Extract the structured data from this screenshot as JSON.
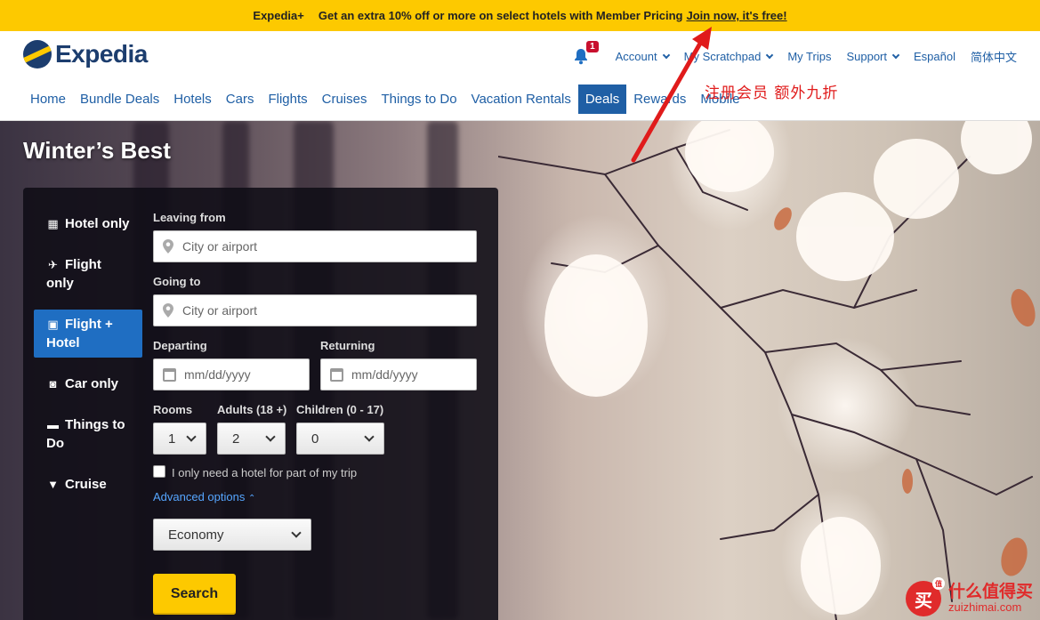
{
  "promo": {
    "brand": "Expedia+",
    "message": "Get an extra 10% off or more on select hotels with Member Pricing",
    "join_link": "Join now, it's free!"
  },
  "header": {
    "logo_text": "Expedia",
    "notification_count": "1",
    "utility_links": [
      {
        "label": "Account",
        "dropdown": true
      },
      {
        "label": "My Scratchpad",
        "dropdown": true
      },
      {
        "label": "My Trips",
        "dropdown": false
      },
      {
        "label": "Support",
        "dropdown": true
      },
      {
        "label": "Español",
        "dropdown": false
      },
      {
        "label": "简体中文",
        "dropdown": false
      }
    ],
    "nav": [
      {
        "label": "Home",
        "active": false
      },
      {
        "label": "Bundle Deals",
        "active": false
      },
      {
        "label": "Hotels",
        "active": false
      },
      {
        "label": "Cars",
        "active": false
      },
      {
        "label": "Flights",
        "active": false
      },
      {
        "label": "Cruises",
        "active": false
      },
      {
        "label": "Things to Do",
        "active": false
      },
      {
        "label": "Vacation Rentals",
        "active": false
      },
      {
        "label": "Deals",
        "active": true
      },
      {
        "label": "Rewards",
        "active": false
      },
      {
        "label": "Mobile",
        "active": false
      }
    ]
  },
  "annotation": {
    "text": "注册会员  额外九折",
    "color": "#e01b1b"
  },
  "hero": {
    "title": "Winter’s Best"
  },
  "search": {
    "tabs": [
      {
        "label": "Hotel only",
        "icon": "building-icon",
        "active": false
      },
      {
        "label": "Flight only",
        "icon": "plane-icon",
        "active": false
      },
      {
        "label": "Flight + Hotel",
        "icon": "suitcase-icon",
        "active": true
      },
      {
        "label": "Car only",
        "icon": "car-icon",
        "active": false
      },
      {
        "label": "Things to Do",
        "icon": "ticket-icon",
        "active": false
      },
      {
        "label": "Cruise",
        "icon": "ship-icon",
        "active": false
      }
    ],
    "leaving_from": {
      "label": "Leaving from",
      "placeholder": "City or airport"
    },
    "going_to": {
      "label": "Going to",
      "placeholder": "City or airport"
    },
    "departing": {
      "label": "Departing",
      "placeholder": "mm/dd/yyyy"
    },
    "returning": {
      "label": "Returning",
      "placeholder": "mm/dd/yyyy"
    },
    "rooms": {
      "label": "Rooms",
      "value": "1"
    },
    "adults": {
      "label": "Adults (18 +)",
      "value": "2"
    },
    "children": {
      "label": "Children (0 - 17)",
      "value": "0"
    },
    "partial_hotel_label": "I only need a hotel for part of my trip",
    "advanced_options": "Advanced options",
    "cabin_class": "Economy",
    "search_button": "Search"
  },
  "watermark": {
    "logo_char": "买",
    "badge": "值",
    "name": "什么值得买",
    "url": "zuizhimai.com"
  },
  "colors": {
    "promo_bg": "#fdc900",
    "link_blue": "#1f5fa5",
    "active_tab": "#1f6ec2",
    "search_yellow": "#fdc900"
  }
}
